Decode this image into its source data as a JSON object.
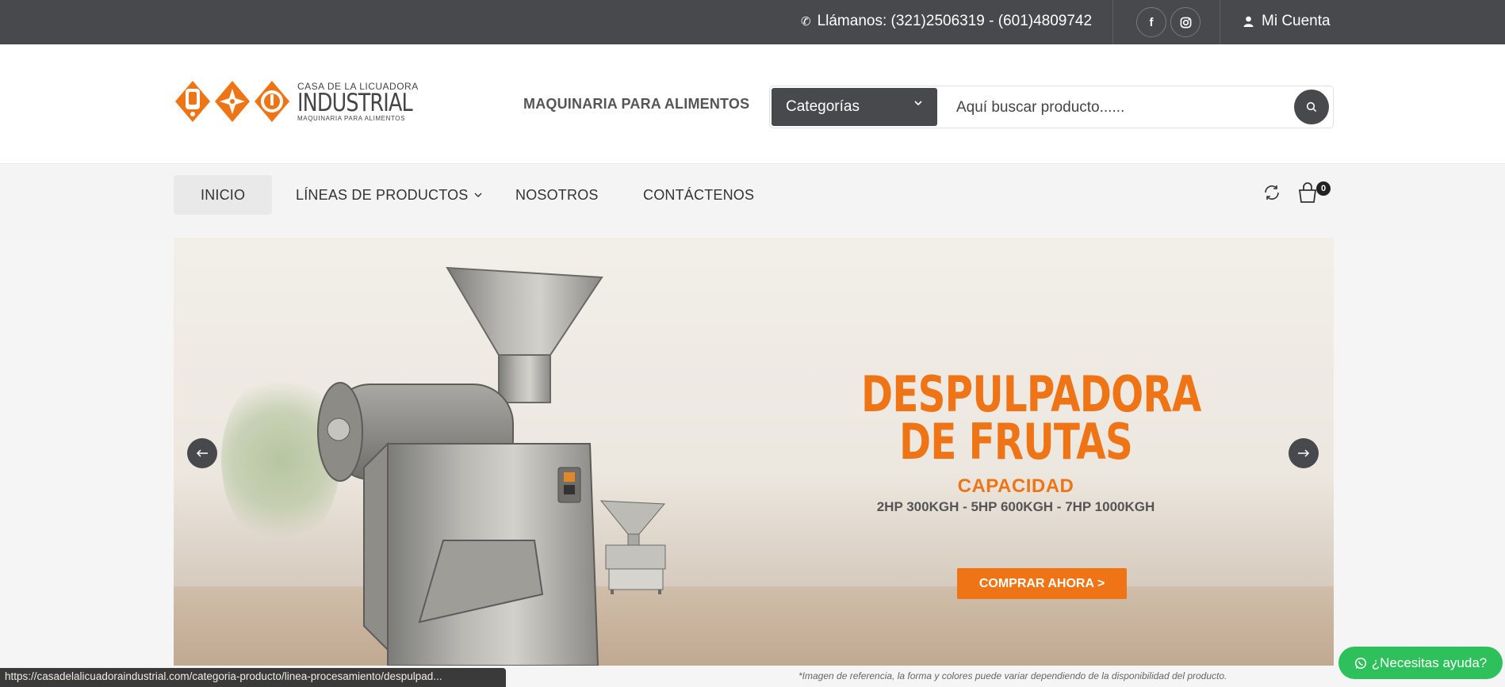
{
  "topbar": {
    "phone_label": "Llámanos: (321)2506319 - (601)4809742",
    "facebook_label": "f",
    "account_label": "Mi Cuenta"
  },
  "header": {
    "logo_line1": "CASA DE LA LICUADORA",
    "logo_line2": "INDUSTRIAL",
    "logo_line3": "MAQUINARIA PARA ALIMENTOS",
    "tagline": "MAQUINARIA PARA ALIMENTOS",
    "category_select": "Categorías",
    "search_placeholder": "Aquí buscar producto......"
  },
  "nav": {
    "items": [
      {
        "label": "INICIO"
      },
      {
        "label": "LÍNEAS DE PRODUCTOS"
      },
      {
        "label": "NOSOTROS"
      },
      {
        "label": "CONTÁCTENOS"
      }
    ],
    "cart_count": "0"
  },
  "slider": {
    "headline": "DESPULPADORA DE FRUTAS",
    "capacity_title": "CAPACIDAD",
    "capacity_values": "2HP 300KGH - 5HP 600KGH - 7HP 1000KGH",
    "cta": "COMPRAR AHORA >",
    "disclaimer": "*Imagen de referencia, la forma y colores puede variar dependiendo de la disponibilidad del producto."
  },
  "statusbar": {
    "url": "https://casadelalicuadoraindustrial.com/categoria-producto/linea-procesamiento/despulpad..."
  },
  "help": {
    "label": "¿Necesitas ayuda?"
  },
  "colors": {
    "accent": "#ef7416",
    "dark": "#47494c",
    "whatsapp": "#2ec05b"
  }
}
